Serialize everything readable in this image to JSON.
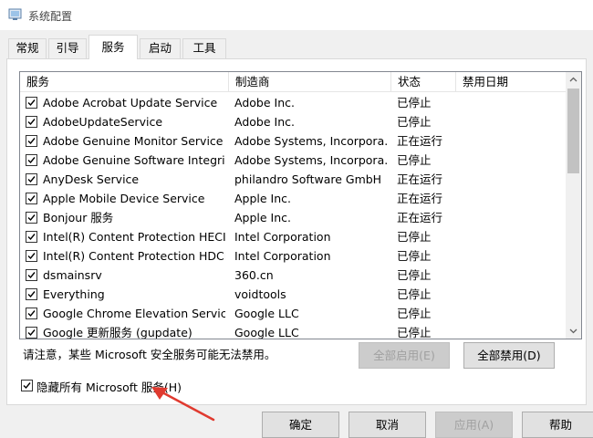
{
  "window": {
    "title": "系统配置"
  },
  "tabs": [
    {
      "label": "常规",
      "active": false
    },
    {
      "label": "引导",
      "active": false
    },
    {
      "label": "服务",
      "active": true
    },
    {
      "label": "启动",
      "active": false
    },
    {
      "label": "工具",
      "active": false
    }
  ],
  "table": {
    "columns": [
      "服务",
      "制造商",
      "状态",
      "禁用日期"
    ],
    "rows": [
      {
        "service": "Adobe Acrobat Update Service",
        "maker": "Adobe Inc.",
        "status": "已停止",
        "checked": true
      },
      {
        "service": "AdobeUpdateService",
        "maker": "Adobe Inc.",
        "status": "已停止",
        "checked": true
      },
      {
        "service": "Adobe Genuine Monitor Service",
        "maker": "Adobe Systems, Incorpora...",
        "status": "正在运行",
        "checked": true
      },
      {
        "service": "Adobe Genuine Software Integrit...",
        "maker": "Adobe Systems, Incorpora...",
        "status": "已停止",
        "checked": true
      },
      {
        "service": "AnyDesk Service",
        "maker": "philandro Software GmbH",
        "status": "正在运行",
        "checked": true
      },
      {
        "service": "Apple Mobile Device Service",
        "maker": "Apple Inc.",
        "status": "正在运行",
        "checked": true
      },
      {
        "service": "Bonjour 服务",
        "maker": "Apple Inc.",
        "status": "正在运行",
        "checked": true
      },
      {
        "service": "Intel(R) Content Protection HECI ...",
        "maker": "Intel Corporation",
        "status": "已停止",
        "checked": true
      },
      {
        "service": "Intel(R) Content Protection HDCP...",
        "maker": "Intel Corporation",
        "status": "已停止",
        "checked": true
      },
      {
        "service": "dsmainsrv",
        "maker": "360.cn",
        "status": "已停止",
        "checked": true
      },
      {
        "service": "Everything",
        "maker": "voidtools",
        "status": "已停止",
        "checked": true
      },
      {
        "service": "Google Chrome Elevation Servic...",
        "maker": "Google LLC",
        "status": "已停止",
        "checked": true
      },
      {
        "service": "Google 更新服务 (gupdate)",
        "maker": "Google LLC",
        "status": "已停止",
        "checked": true
      }
    ]
  },
  "note": "请注意，某些 Microsoft 安全服务可能无法禁用。",
  "buttons": {
    "enable_all": "全部启用(E)",
    "disable_all": "全部禁用(D)",
    "ok": "确定",
    "cancel": "取消",
    "apply": "应用(A)",
    "help": "帮助"
  },
  "hide_ms": {
    "label": "隐藏所有 Microsoft 服务(H)",
    "checked": true
  },
  "colors": {
    "annotation_arrow": "#e03a2f"
  }
}
